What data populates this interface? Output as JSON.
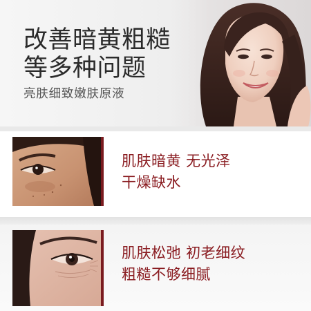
{
  "hero": {
    "title_line1": "改善暗黄粗糙",
    "title_line2": "等多种问题",
    "subtitle": "亮肤细致嫩肤原液"
  },
  "issues": [
    {
      "line1": "肌肤暗黄 无光泽",
      "line2": "干燥缺水"
    },
    {
      "line1": "肌肤松弛 初老细纹",
      "line2": "粗糙不够细腻"
    }
  ],
  "colors": {
    "accent": "#7a1b1f",
    "issue_text": "#8a1c21",
    "title_text": "#2b2b2b"
  }
}
